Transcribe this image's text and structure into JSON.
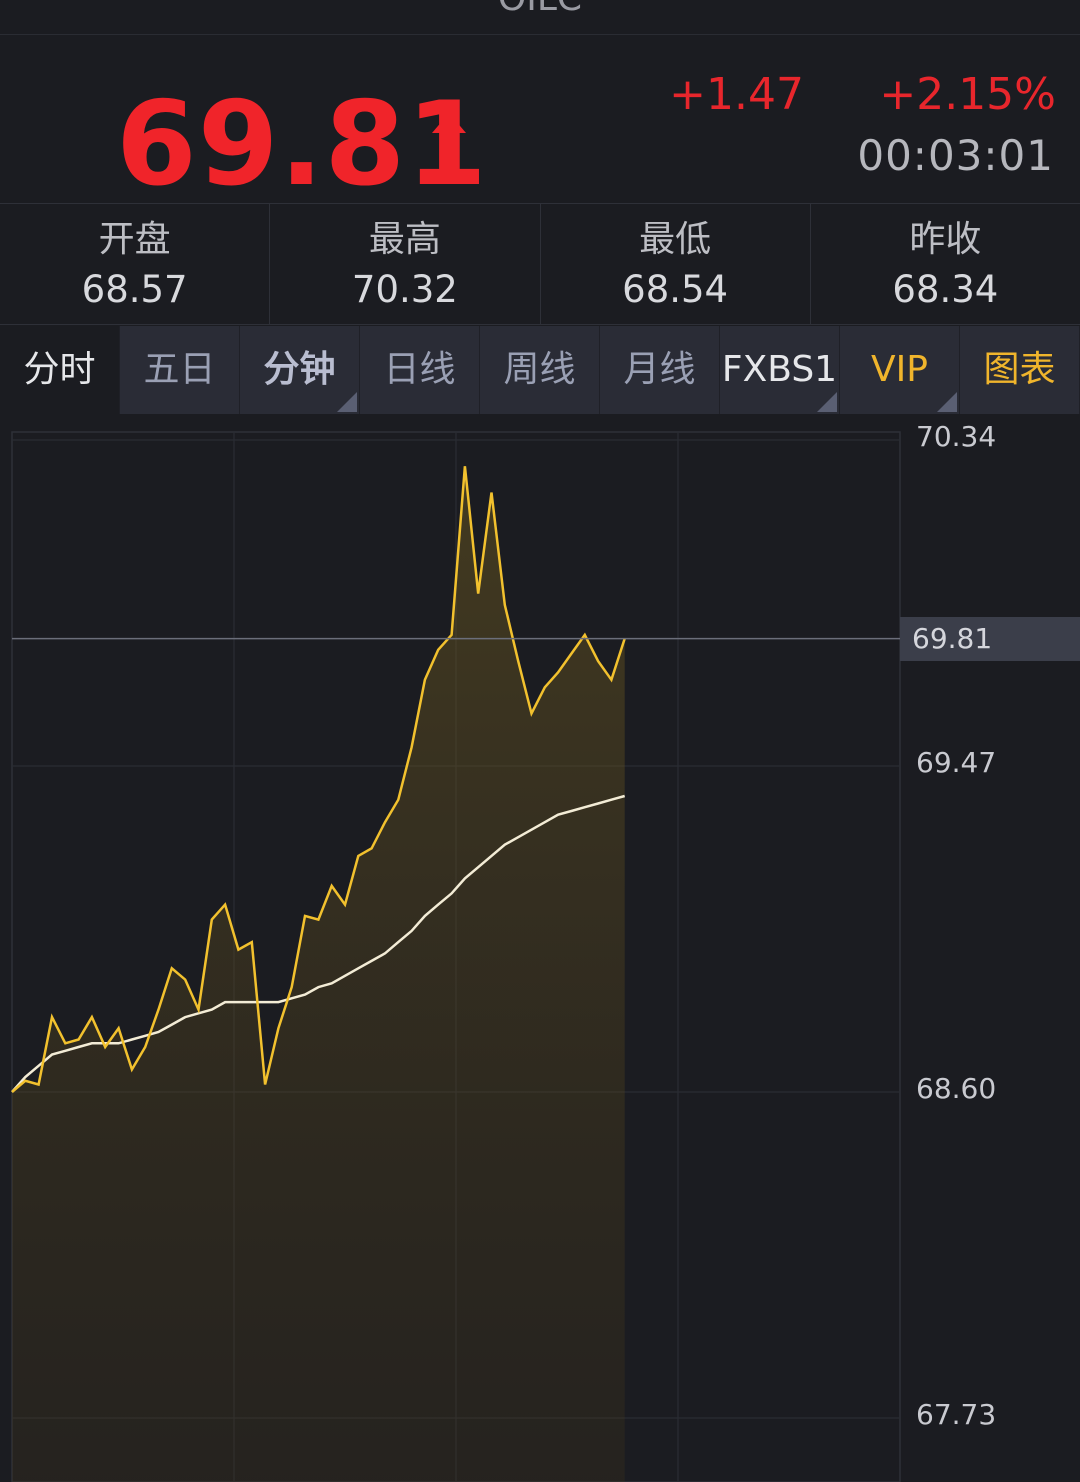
{
  "header": {
    "symbol": "OILC"
  },
  "quote": {
    "price": "69.81",
    "change": "+1.47",
    "change_pct": "+2.15%",
    "time": "00:03:01",
    "direction": "up",
    "up_color": "#f0242a"
  },
  "stats": [
    {
      "label": "开盘",
      "value": "68.57"
    },
    {
      "label": "最高",
      "value": "70.32"
    },
    {
      "label": "最低",
      "value": "68.54"
    },
    {
      "label": "昨收",
      "value": "68.34"
    }
  ],
  "tabs": [
    {
      "label": "分时",
      "active": true
    },
    {
      "label": "五日"
    },
    {
      "label": "分钟",
      "has_dropdown": true
    },
    {
      "label": "日线"
    },
    {
      "label": "周线"
    },
    {
      "label": "月线"
    },
    {
      "label": "FXBS1",
      "has_dropdown": true
    },
    {
      "label": "VIP",
      "has_dropdown": true
    },
    {
      "label": "图表"
    }
  ],
  "chart_data": {
    "type": "line",
    "y_ticks": [
      "70.34",
      "69.47",
      "68.60",
      "67.73"
    ],
    "ylim": [
      67.6,
      70.4
    ],
    "current_price_label": "69.81",
    "current_price": 69.81,
    "x_progress": [
      0,
      0.015,
      0.03,
      0.045,
      0.06,
      0.075,
      0.09,
      0.105,
      0.12,
      0.135,
      0.15,
      0.165,
      0.18,
      0.195,
      0.21,
      0.225,
      0.24,
      0.255,
      0.27,
      0.285,
      0.3,
      0.315,
      0.33,
      0.345,
      0.36,
      0.375,
      0.39,
      0.405,
      0.42,
      0.435,
      0.45,
      0.465,
      0.48,
      0.495,
      0.51,
      0.525,
      0.54,
      0.555,
      0.57,
      0.585,
      0.6,
      0.615,
      0.63,
      0.645,
      0.66,
      0.675,
      0.69
    ],
    "series": [
      {
        "color": "#f2c12e",
        "values": [
          68.6,
          68.63,
          68.62,
          68.8,
          68.73,
          68.74,
          68.8,
          68.72,
          68.77,
          68.66,
          68.72,
          68.82,
          68.93,
          68.9,
          68.82,
          69.06,
          69.1,
          68.98,
          69.0,
          68.62,
          68.77,
          68.88,
          69.07,
          69.06,
          69.15,
          69.1,
          69.23,
          69.25,
          69.32,
          69.38,
          69.52,
          69.7,
          69.78,
          69.82,
          70.27,
          69.93,
          70.2,
          69.9,
          69.75,
          69.61,
          69.68,
          69.72,
          69.77,
          69.82,
          69.75,
          69.7,
          69.81
        ]
      },
      {
        "color": "#f3ecd6",
        "values": [
          68.6,
          68.64,
          68.67,
          68.7,
          68.71,
          68.72,
          68.73,
          68.73,
          68.73,
          68.74,
          68.75,
          68.76,
          68.78,
          68.8,
          68.81,
          68.82,
          68.84,
          68.84,
          68.84,
          68.84,
          68.84,
          68.85,
          68.86,
          68.88,
          68.89,
          68.91,
          68.93,
          68.95,
          68.97,
          69.0,
          69.03,
          69.07,
          69.1,
          69.13,
          69.17,
          69.2,
          69.23,
          69.26,
          69.28,
          69.3,
          69.32,
          69.34,
          69.35,
          69.36,
          69.37,
          69.38,
          69.39
        ]
      }
    ],
    "grid": true
  }
}
